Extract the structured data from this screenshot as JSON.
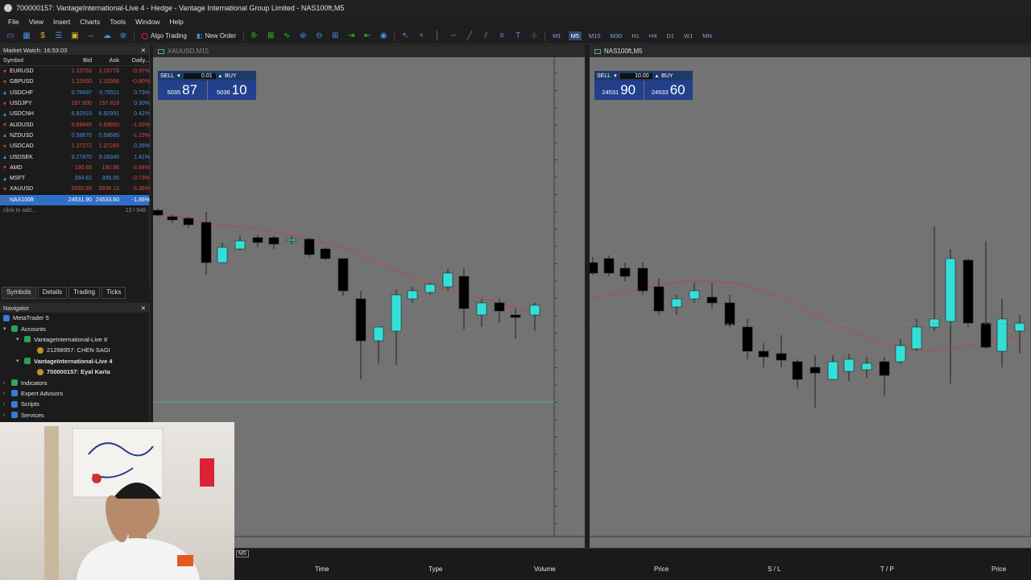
{
  "window": {
    "title": "700000157: VantageInternational-Live 4 - Hedge - Vantage International Group Limited - NAS100ft,M5"
  },
  "menu": [
    "File",
    "View",
    "Insert",
    "Charts",
    "Tools",
    "Window",
    "Help"
  ],
  "toolbar": {
    "algo_trading": "Algo Trading",
    "new_order": "New Order",
    "timeframes": [
      "M1",
      "M5",
      "M15",
      "M30",
      "H1",
      "H4",
      "D1",
      "W1",
      "MN"
    ],
    "active_timeframe": "M5"
  },
  "market_watch": {
    "title": "Market Watch: 16:53:03",
    "columns": [
      "Symbol",
      "Bid",
      "Ask",
      "Daily..."
    ],
    "rows": [
      {
        "symbol": "EURUSD",
        "bid": "1.15763",
        "ask": "1.15776",
        "change": "-0.97%",
        "dir": "dn"
      },
      {
        "symbol": "GBPUSD",
        "bid": "1.32950",
        "ask": "1.32966",
        "change": "-0.80%",
        "dir": "dn"
      },
      {
        "symbol": "USDCHF",
        "bid": "0.78497",
        "ask": "0.78511",
        "change": "0.73%",
        "dir": "up"
      },
      {
        "symbol": "USDJPY",
        "bid": "157.800",
        "ask": "157.819",
        "change": "0.30%",
        "dir": "dn"
      },
      {
        "symbol": "USDCNH",
        "bid": "6.92923",
        "ask": "6.92991",
        "change": "0.42%",
        "dir": "up"
      },
      {
        "symbol": "AUDUSD",
        "bid": "0.69845",
        "ask": "0.69860",
        "change": "-1.53%",
        "dir": "dn"
      },
      {
        "symbol": "NZDUSD",
        "bid": "0.58670",
        "ask": "0.58685",
        "change": "-1.23%",
        "dir": "up"
      },
      {
        "symbol": "USDCAD",
        "bid": "1.37272",
        "ask": "1.37283",
        "change": "0.35%",
        "dir": "dn"
      },
      {
        "symbol": "USDSEK",
        "bid": "9.27870",
        "ask": "9.28346",
        "change": "1.41%",
        "dir": "up"
      },
      {
        "symbol": "AMD",
        "bid": "190.65",
        "ask": "190.96",
        "change": "-3.94%",
        "dir": "dn"
      },
      {
        "symbol": "MSFT",
        "bid": "394.81",
        "ask": "395.05",
        "change": "-0.73%",
        "dir": "up"
      },
      {
        "symbol": "XAUUSD",
        "bid": "5035.89",
        "ask": "5036.12",
        "change": "-5.38%",
        "dir": "dn"
      },
      {
        "symbol": "NAS100ft",
        "bid": "24531.90",
        "ask": "24533.60",
        "change": "-1.86%",
        "dir": "dn"
      }
    ],
    "add_label": "click to add...",
    "count": "13 / 948"
  },
  "mw_tabs": [
    "Symbols",
    "Details",
    "Trading",
    "Ticks"
  ],
  "navigator": {
    "title": "Navigator",
    "items": [
      "MetaTrader 5",
      "Accounts",
      "VantageInternational-Live 8",
      "21298957: CHEN SAGI",
      "VantageInternational-Live 4",
      "700000157: Eyal Karta",
      "Indicators",
      "Expert Advisors",
      "Scripts",
      "Services"
    ]
  },
  "chart_left": {
    "title": "XAUUSD,M15",
    "sell": "SELL",
    "buy": "BUY",
    "lot": "0.01",
    "bid_small": "5035",
    "bid_big": "87",
    "ask_small": "5036",
    "ask_big": "10"
  },
  "chart_right": {
    "title": "NAS100ft,M5",
    "sell": "SELL",
    "buy": "BUY",
    "lot": "10.00",
    "bid_small": "24531",
    "bid_big": "90",
    "ask_small": "24533",
    "ask_big": "60"
  },
  "bottom": {
    "tab": "M5",
    "headers": [
      "Time",
      "Type",
      "Volume",
      "Price",
      "S / L",
      "T / P",
      "Price"
    ]
  },
  "colors": {
    "bull": "#33e0d9",
    "bear": "#000000",
    "ma": "#e23030",
    "accent": "#2f6fc8"
  }
}
